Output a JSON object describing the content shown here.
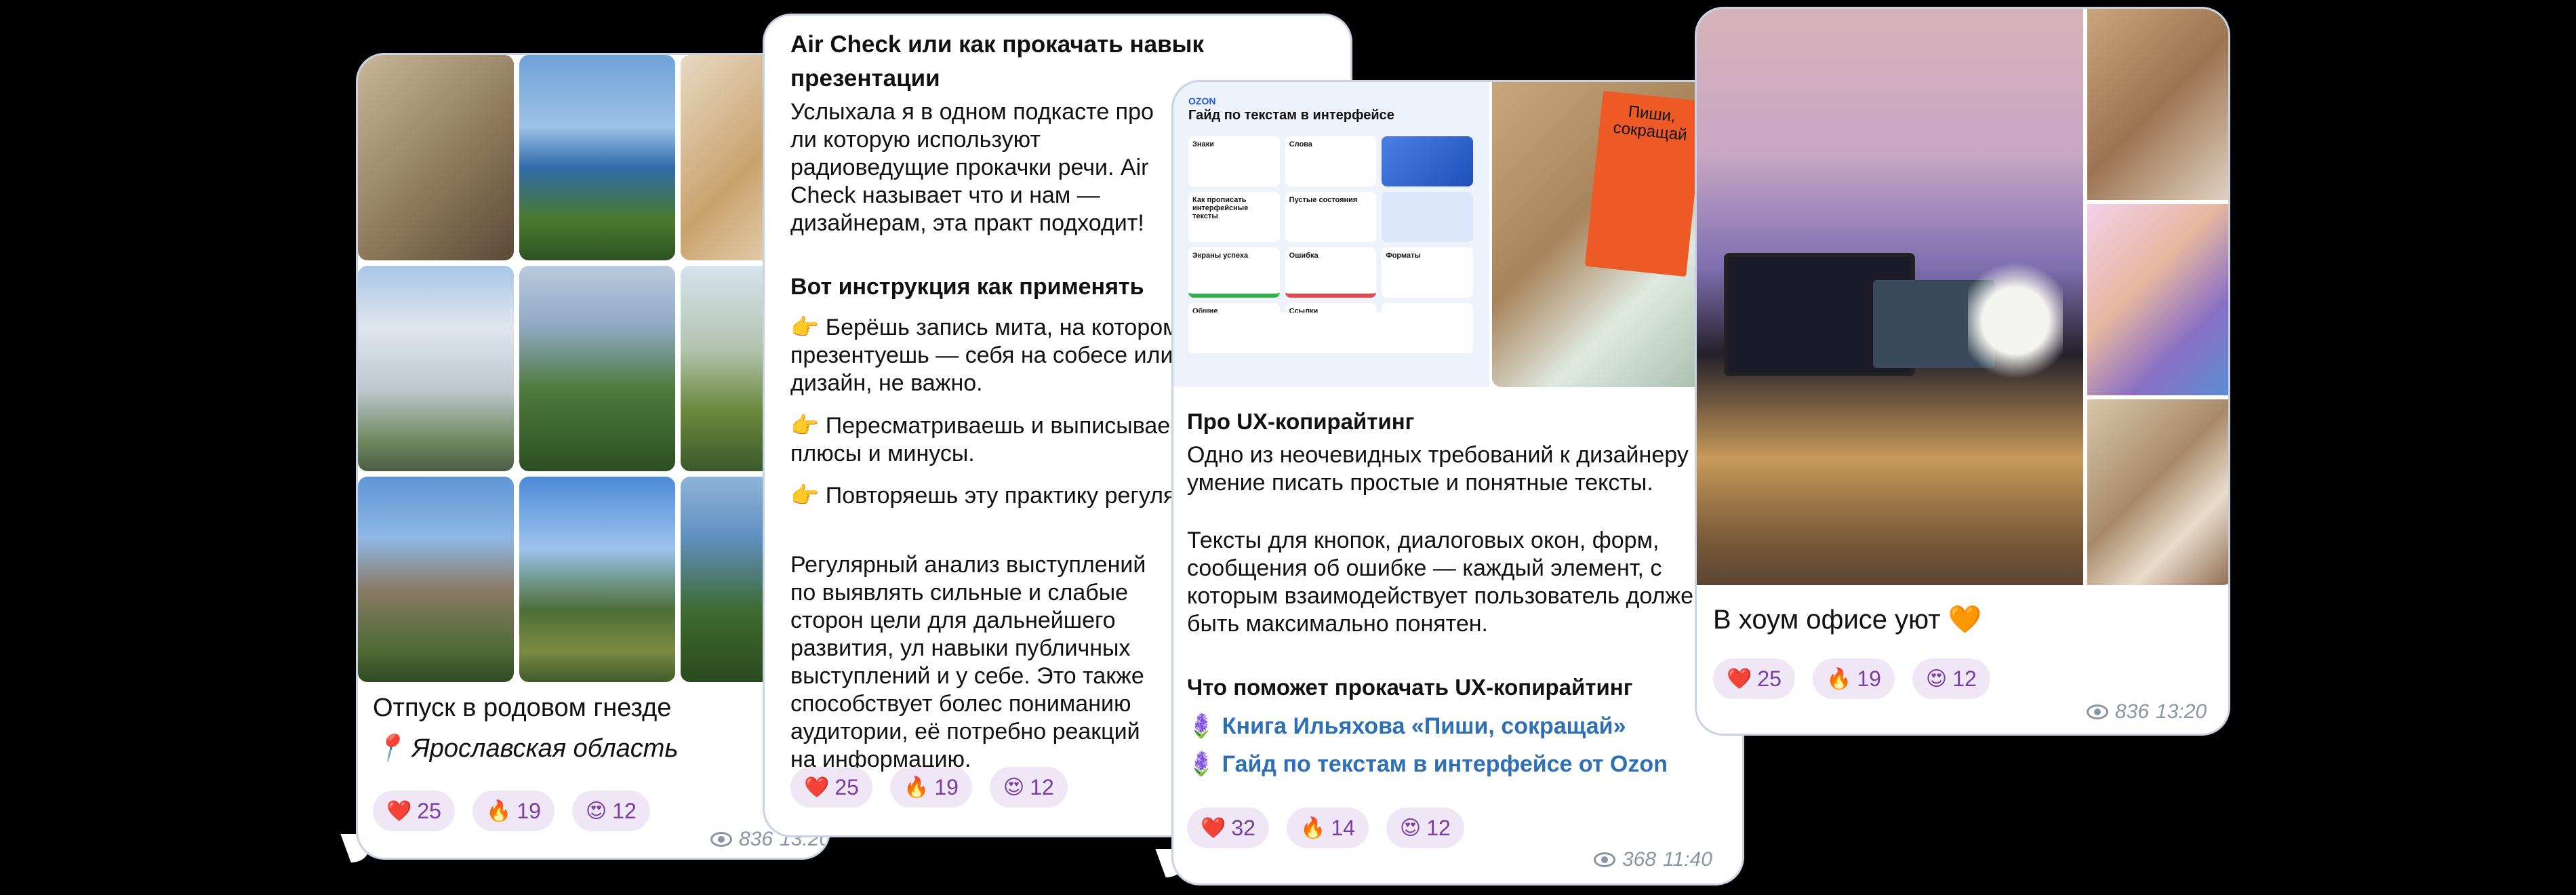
{
  "posts": {
    "vacation": {
      "caption": "Отпуск в родовом гнезде",
      "location_emoji": "📍",
      "location": "Ярославская область",
      "reactions": [
        {
          "emoji": "❤️",
          "count": "25"
        },
        {
          "emoji": "🔥",
          "count": "19"
        },
        {
          "emoji": "😍",
          "count": "12"
        }
      ],
      "views": "836",
      "time": "13:20"
    },
    "aircheck": {
      "title": "Air Check или как прокачать навык презентации",
      "intro": "Услыхала я в одном подкасте про ли которую используют радиоведущие прокачки речи. Air Check называет что и нам — дизайнерам, эта практ подходит!",
      "howto_title": "Вот инструкция как применять",
      "steps": [
        "Берёшь запись мита, на котором презентуешь — себя на собесе или дизайн, не важно.",
        "Пересматриваешь и выписывае плюсы и минусы.",
        "Повторяешь эту практику регуля"
      ],
      "outro": "Регулярный анализ выступлений по выявлять сильные и слабые сторон цели для дальнейшего развития, ул навыки публичных выступлений и у себе. Это также способствует болес пониманию аудитории, её потребно реакций на информацию.",
      "reactions": [
        {
          "emoji": "❤️",
          "count": "25"
        },
        {
          "emoji": "🔥",
          "count": "19"
        },
        {
          "emoji": "😍",
          "count": "12"
        }
      ]
    },
    "ux": {
      "ozon_logo": "OZON",
      "guide_title": "Гайд по текстам в интерфейсе",
      "guide_cells": [
        "Знаки",
        "Слова",
        "Как прописать интерфейсные тексты",
        "Пустые состояния",
        "Экраны успеха",
        "Ошибка",
        "Форматы",
        "Общие",
        "Ссылки"
      ],
      "book_title": "Пиши, сокращай",
      "title": "Про UX-копирайтинг",
      "p1": "Одно из неочевидных требований к дизайнеру — умение писать простые и понятные тексты.",
      "p2": "Тексты для кнопок, диалоговых окон, форм, сообщения об ошибке — каждый элемент, с которым взаимодействует пользователь должен быть максимально понятен.",
      "help_title": "Что поможет прокачать UX-копирайтинг",
      "links": [
        "Книга Ильяхова «Пиши, сокращай»",
        "Гайд по текстам в интерфейсе от Ozon"
      ],
      "reactions": [
        {
          "emoji": "❤️",
          "count": "32"
        },
        {
          "emoji": "🔥",
          "count": "14"
        },
        {
          "emoji": "😍",
          "count": "12"
        }
      ],
      "views": "368",
      "time": "11:40"
    },
    "office": {
      "caption": "В хоум офисе уют 🧡",
      "reactions": [
        {
          "emoji": "❤️",
          "count": "25"
        },
        {
          "emoji": "🔥",
          "count": "19"
        },
        {
          "emoji": "😍",
          "count": "12"
        }
      ],
      "views": "836",
      "time": "13:20"
    }
  },
  "colors": {
    "background": "#000000",
    "bubble": "#ffffff",
    "reaction_bg": "#f0e7f6",
    "reaction_text": "#7a3da0",
    "link": "#2e6fb6",
    "meta": "#8a95a3"
  }
}
